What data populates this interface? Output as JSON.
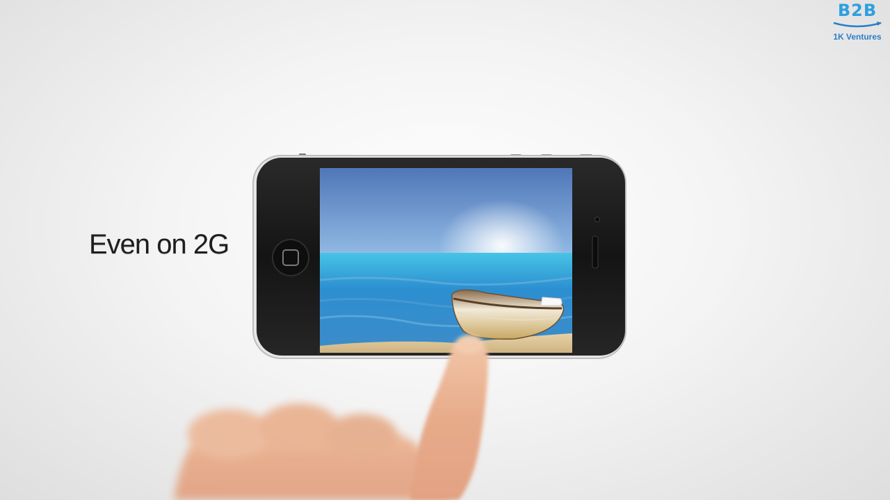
{
  "headline": "Even on 2G",
  "logo": {
    "mark": "B2B",
    "subtitle": "1K Ventures",
    "color": "#2e9fe0"
  },
  "phone": {
    "body_color": "#1b1b1b",
    "frame_color": "#d8d8d8",
    "screen_content": "beach scene with boat"
  },
  "icons": {
    "home_button": "home-button-icon",
    "speaker": "speaker-icon",
    "camera": "camera-icon"
  }
}
